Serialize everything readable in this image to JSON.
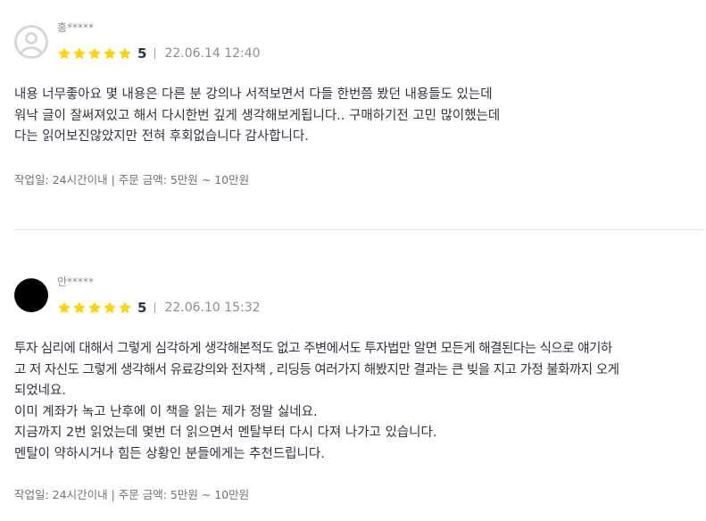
{
  "reviews": [
    {
      "name": "홍*****",
      "avatar": "default-user-avatar",
      "rating": 5,
      "score": "5",
      "date": "22.06.14 12:40",
      "lines": [
        "내용 너무좋아요 몇 내용은 다른 분 강의나 서적보면서 다들 한번쯤 봤던 내용들도 있는데",
        "워낙 글이 잘써져있고 해서 다시한번 깊게 생각해보게됩니다.. 구매하기전 고민 많이했는데",
        "다는 읽어보진않았지만 전혀 후회없습니다 감사합니다."
      ],
      "meta": "작업일: 24시간이내 | 주문 금액: 5만원 ~ 10만원"
    },
    {
      "name": "안*****",
      "avatar": "black-circle-avatar",
      "rating": 5,
      "score": "5",
      "date": "22.06.10 15:32",
      "lines": [
        "투자 심리에 대해서 그렇게 심각하게 생각해본적도 없고 주변에서도 투자법만 알면 모든게 해결된다는 식으로 얘기하",
        "고 저 자신도 그렇게 생각해서 유료강의와 전자책 , 리딩등 여러가지 해봤지만 결과는 큰 빚을 지고 가정 불화까지 오게",
        "되었네요.",
        "이미 계좌가 녹고 난후에 이 책을 읽는 제가 정말 싫네요.",
        "지금까지 2번 읽었는데 몇번 더 읽으면서 멘탈부터 다시 다져 나가고 있습니다.",
        "멘탈이 약하시거나 힘든 상황인 분들에게는 추천드립니다."
      ],
      "meta": "작업일: 24시간이내 | 주문 금액: 5만원 ~ 10만원"
    }
  ],
  "colors": {
    "star": "#FFD400",
    "text": "#303441",
    "muted": "#8a8d96"
  },
  "icons": {
    "star": "star-icon"
  }
}
